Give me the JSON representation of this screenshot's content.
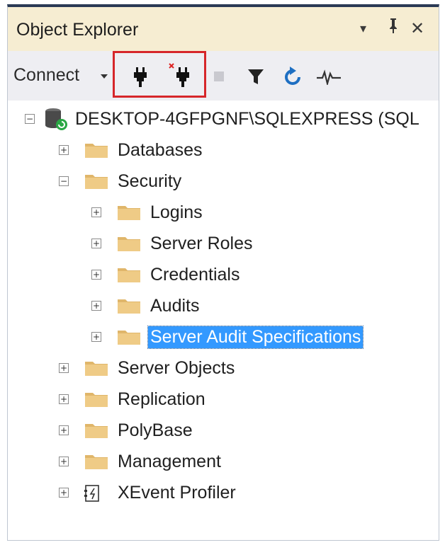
{
  "window": {
    "title": "Object Explorer",
    "controls": [
      "▾",
      "ᛰ",
      "✕"
    ]
  },
  "toolbar": {
    "connect_label": "Connect",
    "icons": [
      "connect-icon",
      "disconnect-icon",
      "stop-icon",
      "filter-icon",
      "refresh-icon",
      "activity-monitor-icon"
    ],
    "highlight_color": "#d6262a"
  },
  "tree": {
    "server": {
      "label": "DESKTOP-4GFPGNF\\SQLEXPRESS (SQL",
      "expanded": true
    },
    "nodes": [
      {
        "label": "Databases",
        "level": 1,
        "expanded": false,
        "icon": "folder-icon"
      },
      {
        "label": "Security",
        "level": 1,
        "expanded": true,
        "icon": "folder-icon"
      },
      {
        "label": "Logins",
        "level": 2,
        "expanded": false,
        "icon": "folder-icon"
      },
      {
        "label": "Server Roles",
        "level": 2,
        "expanded": false,
        "icon": "folder-icon"
      },
      {
        "label": "Credentials",
        "level": 2,
        "expanded": false,
        "icon": "folder-icon"
      },
      {
        "label": "Audits",
        "level": 2,
        "expanded": false,
        "icon": "folder-icon"
      },
      {
        "label": "Server Audit Specifications",
        "level": 2,
        "expanded": false,
        "icon": "folder-icon",
        "selected": true
      },
      {
        "label": "Server Objects",
        "level": 1,
        "expanded": false,
        "icon": "folder-icon"
      },
      {
        "label": "Replication",
        "level": 1,
        "expanded": false,
        "icon": "folder-icon"
      },
      {
        "label": "PolyBase",
        "level": 1,
        "expanded": false,
        "icon": "folder-icon"
      },
      {
        "label": "Management",
        "level": 1,
        "expanded": false,
        "icon": "folder-icon"
      },
      {
        "label": "XEvent Profiler",
        "level": 1,
        "expanded": false,
        "icon": "xevent-profiler-icon"
      }
    ]
  },
  "colors": {
    "selection": "#3399ff",
    "folder": "#e8c27a",
    "title_bg": "#f6edd2"
  }
}
